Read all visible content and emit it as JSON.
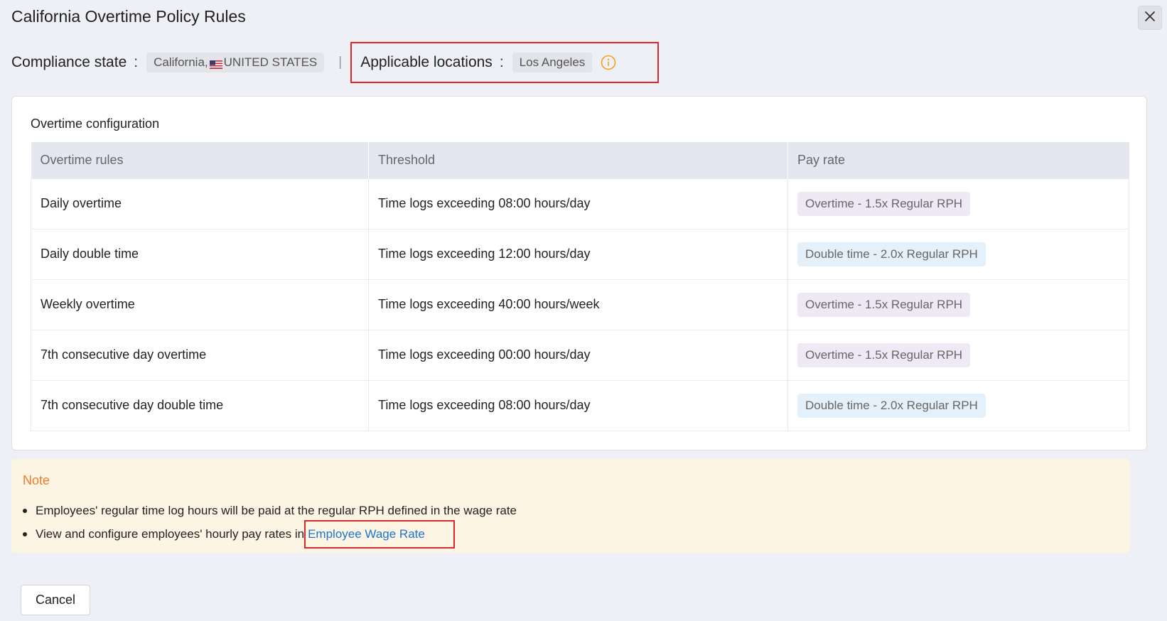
{
  "dialog": {
    "title": "California Overtime Policy Rules",
    "close_icon": "close-icon"
  },
  "meta": {
    "compliance_label": "Compliance state",
    "colon": ":",
    "compliance_state": "California,",
    "compliance_country": "UNITED STATES",
    "flag_icon": "us-flag-icon",
    "separator": "|",
    "locations_label": "Applicable locations",
    "location": "Los Angeles",
    "info_icon": "info-icon"
  },
  "overtime": {
    "section_title": "Overtime configuration",
    "columns": [
      "Overtime rules",
      "Threshold",
      "Pay rate"
    ],
    "rows": [
      {
        "rule": "Daily overtime",
        "threshold": "Time logs exceeding 08:00 hours/day",
        "pay_rate": "Overtime - 1.5x Regular RPH",
        "kind": "ot"
      },
      {
        "rule": "Daily double time",
        "threshold": "Time logs exceeding 12:00 hours/day",
        "pay_rate": "Double time - 2.0x Regular RPH",
        "kind": "dt"
      },
      {
        "rule": "Weekly overtime",
        "threshold": "Time logs exceeding 40:00 hours/week",
        "pay_rate": "Overtime - 1.5x Regular RPH",
        "kind": "ot"
      },
      {
        "rule": "7th consecutive day overtime",
        "threshold": "Time logs exceeding 00:00 hours/day",
        "pay_rate": "Overtime - 1.5x Regular RPH",
        "kind": "ot"
      },
      {
        "rule": "7th consecutive day double time",
        "threshold": "Time logs exceeding 08:00 hours/day",
        "pay_rate": "Double time - 2.0x Regular RPH",
        "kind": "dt"
      }
    ]
  },
  "note": {
    "title": "Note",
    "line1": "Employees' regular time log hours will be paid at the regular RPH defined in the wage rate",
    "line2_prefix": "View and configure employees' hourly pay rates in",
    "line2_link": "Employee Wage Rate"
  },
  "footer": {
    "cancel_label": "Cancel"
  },
  "colors": {
    "highlight_border": "#e0262b",
    "link": "#1b75d0",
    "note_title": "#f07b2c",
    "info_icon": "#f0a020"
  }
}
